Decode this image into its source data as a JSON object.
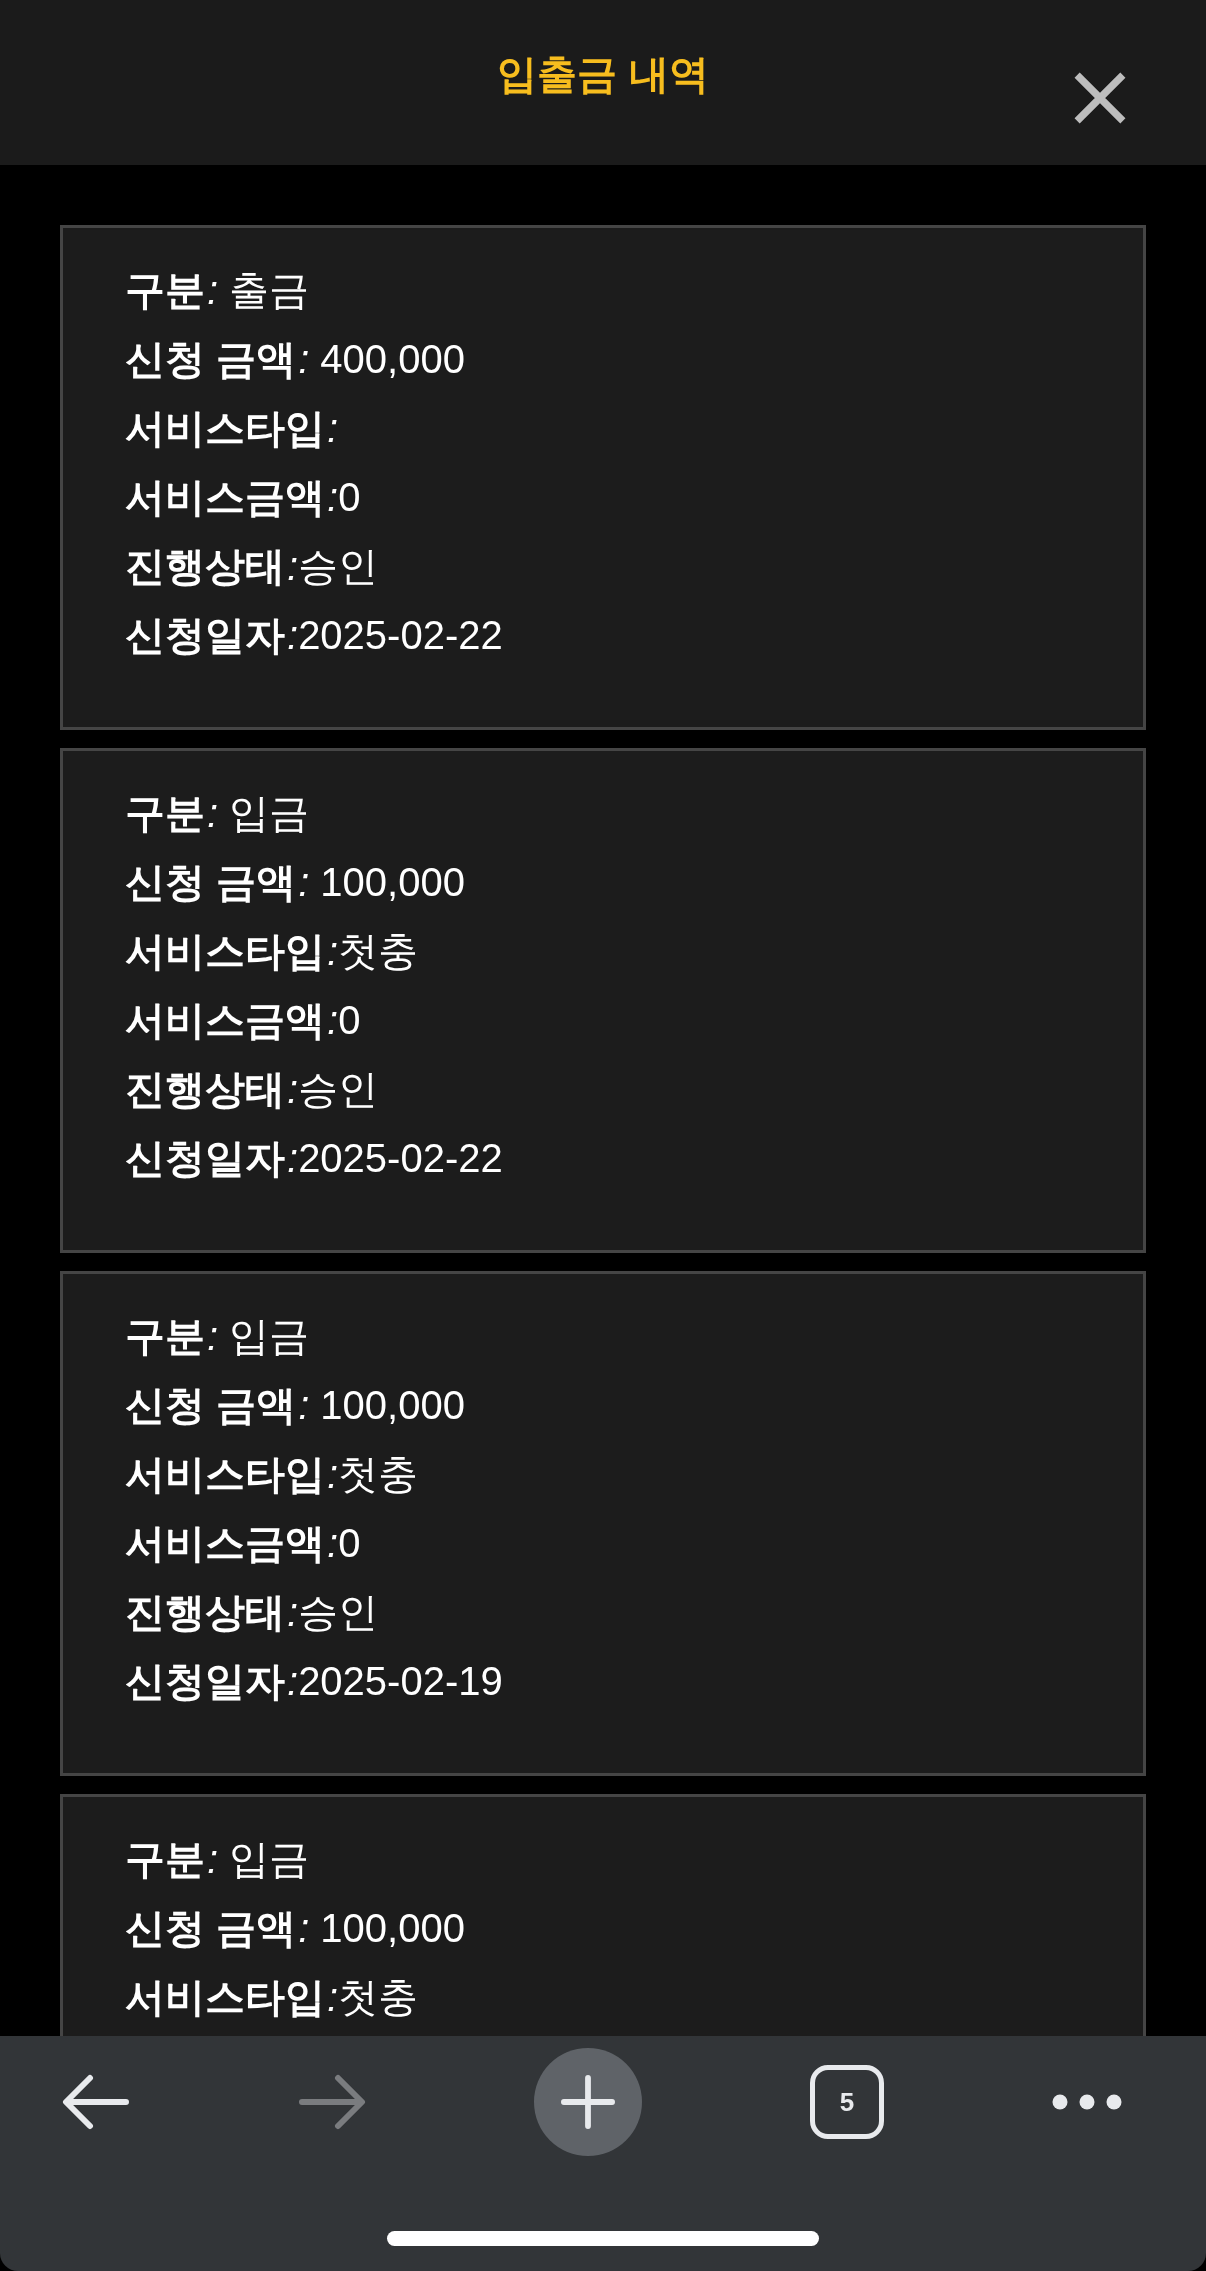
{
  "header": {
    "title": "입출금 내역"
  },
  "records": [
    {
      "rows": [
        {
          "label": "구분",
          "separator": ":",
          "value": " 출금"
        },
        {
          "label": "신청 금액",
          "separator": ":",
          "value": " 400,000"
        },
        {
          "label": "서비스타입",
          "separator": ":"
        },
        {
          "label": "서비스금액",
          "separator": ":",
          "value": "0"
        },
        {
          "label": "진행상태",
          "separator": ":",
          "value": "승인"
        },
        {
          "label": "신청일자",
          "separator": ":",
          "value": "2025-02-22"
        }
      ]
    },
    {
      "rows": [
        {
          "label": "구분",
          "separator": ":",
          "value": " 입금"
        },
        {
          "label": "신청 금액",
          "separator": ":",
          "value": " 100,000"
        },
        {
          "label": "서비스타입",
          "separator": ":",
          "value": "첫충"
        },
        {
          "label": "서비스금액",
          "separator": ":",
          "value": "0"
        },
        {
          "label": "진행상태",
          "separator": ":",
          "value": "승인"
        },
        {
          "label": "신청일자",
          "separator": ":",
          "value": "2025-02-22"
        }
      ]
    },
    {
      "rows": [
        {
          "label": "구분",
          "separator": ":",
          "value": " 입금"
        },
        {
          "label": "신청 금액",
          "separator": ":",
          "value": " 100,000"
        },
        {
          "label": "서비스타입",
          "separator": ":",
          "value": "첫충"
        },
        {
          "label": "서비스금액",
          "separator": ":",
          "value": "0"
        },
        {
          "label": "진행상태",
          "separator": ":",
          "value": "승인"
        },
        {
          "label": "신청일자",
          "separator": ":",
          "value": "2025-02-19"
        }
      ]
    },
    {
      "rows": [
        {
          "label": "구분",
          "separator": ":",
          "value": " 입금"
        },
        {
          "label": "신청 금액",
          "separator": ":",
          "value": " 100,000"
        },
        {
          "label": "서비스타입",
          "separator": ":",
          "value": "첫충"
        }
      ]
    }
  ],
  "toolbar": {
    "back": {
      "disabled": false
    },
    "forward": {
      "disabled": true
    },
    "tab_count": "5"
  }
}
